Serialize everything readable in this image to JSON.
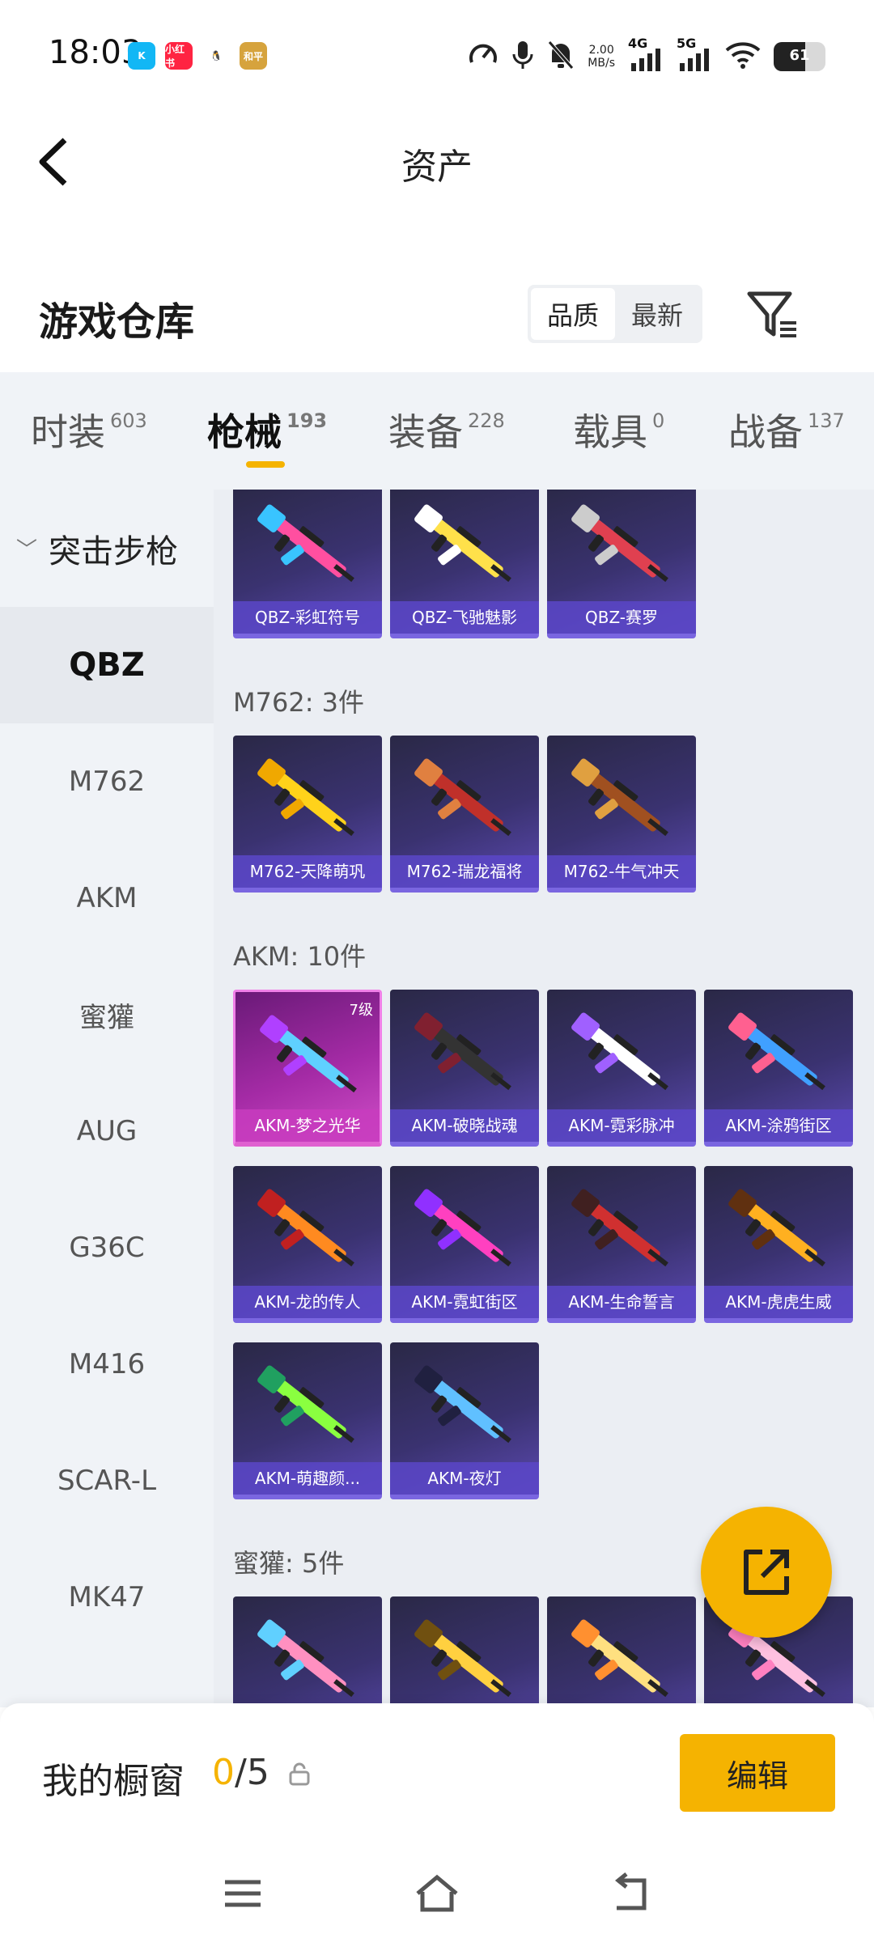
{
  "status_bar": {
    "time": "18:03",
    "app_icons": [
      {
        "name": "kuaishou-icon",
        "label": "K",
        "color": "#12b7f5"
      },
      {
        "name": "xiaohongshu-icon",
        "label": "小红书",
        "color": "#ff2442"
      },
      {
        "name": "qq-icon",
        "label": "🐧",
        "color": "#ffffff"
      },
      {
        "name": "game-app-icon",
        "label": "和平",
        "color": "#d6a33d"
      }
    ],
    "net_speed": "2.00",
    "net_speed_unit": "MB/s",
    "net_4g": "4G",
    "net_5g": "5G",
    "battery": "61",
    "battery_level": 0.61
  },
  "header": {
    "title": "资产"
  },
  "warehouse": {
    "title": "游戏仓库",
    "sort_options": [
      "品质",
      "最新"
    ],
    "active_sort": 0
  },
  "tabs": [
    {
      "label": "时装",
      "count": "603"
    },
    {
      "label": "枪械",
      "count": "193",
      "active": true
    },
    {
      "label": "装备",
      "count": "228"
    },
    {
      "label": "载具",
      "count": "0"
    },
    {
      "label": "战备",
      "count": "137"
    }
  ],
  "sidebar": {
    "group": "突击步枪",
    "items": [
      "QBZ",
      "M762",
      "AKM",
      "蜜獾",
      "AUG",
      "G36C",
      "M416",
      "SCAR-L",
      "MK47"
    ],
    "active_index": 0
  },
  "sections": [
    {
      "label": "",
      "cards": [
        {
          "name": "QBZ-彩虹符号"
        },
        {
          "name": "QBZ-飞驰魅影"
        },
        {
          "name": "QBZ-赛罗"
        }
      ]
    },
    {
      "label": "M762: 3件",
      "cards": [
        {
          "name": "M762-天降萌巩"
        },
        {
          "name": "M762-瑞龙福将"
        },
        {
          "name": "M762-牛气冲天"
        }
      ]
    },
    {
      "label": "AKM: 10件",
      "cards": [
        {
          "name": "AKM-梦之光华",
          "level": "7级",
          "featured": true
        },
        {
          "name": "AKM-破晓战魂"
        },
        {
          "name": "AKM-霓彩脉冲"
        },
        {
          "name": "AKM-涂鸦街区"
        },
        {
          "name": "AKM-龙的传人"
        },
        {
          "name": "AKM-霓虹街区"
        },
        {
          "name": "AKM-生命誓言"
        },
        {
          "name": "AKM-虎虎生威"
        },
        {
          "name": "AKM-萌趣颜..."
        },
        {
          "name": "AKM-夜灯"
        }
      ]
    },
    {
      "label": "蜜獾: 5件",
      "cards": [
        {
          "name": ""
        },
        {
          "name": ""
        },
        {
          "name": ""
        },
        {
          "name": ""
        }
      ]
    }
  ],
  "showcase": {
    "title": "我的橱窗",
    "current": "0",
    "separator": "/",
    "max": "5",
    "edit_label": "编辑"
  },
  "colors": {
    "accent": "#f5b301",
    "card_bg": "#3a3270",
    "card_featured": "#a52ba6"
  }
}
